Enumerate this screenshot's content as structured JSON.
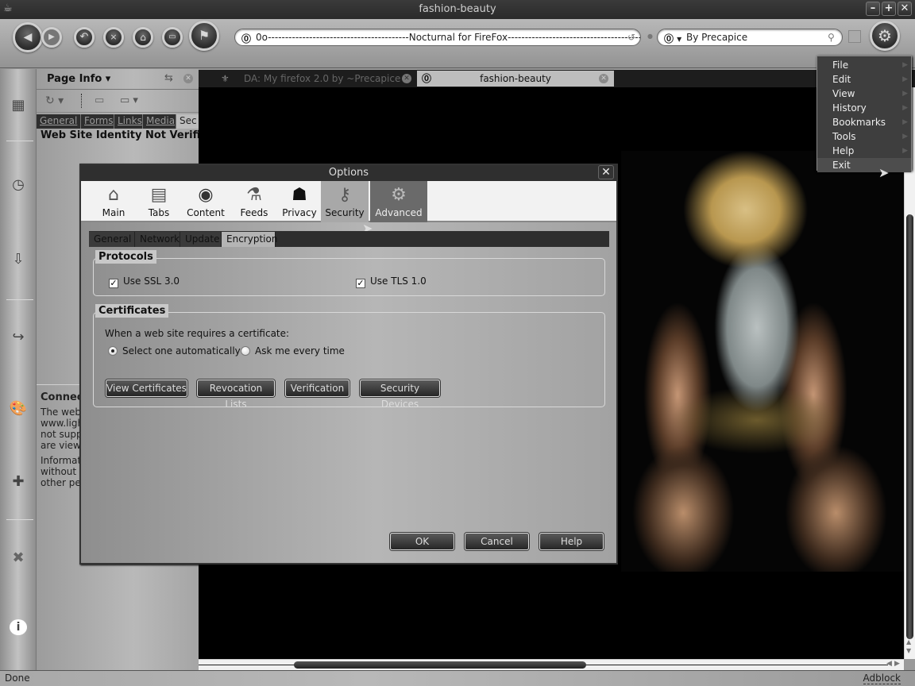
{
  "window": {
    "title": "fashion-beauty",
    "controls": {
      "minimize": "–",
      "maximize": "+",
      "close": "✕"
    }
  },
  "toolbar": {
    "url_value": "0o-----------------------------------------Nocturnal for FireFox---------------------------------------o0",
    "search_value": "By Precapice"
  },
  "sidebar": {
    "title": "Page Info",
    "tabs": [
      {
        "label": "General",
        "active": false
      },
      {
        "label": "Forms",
        "active": false
      },
      {
        "label": "Links",
        "active": false
      },
      {
        "label": "Media",
        "active": false
      },
      {
        "label": "Sec",
        "active": true
      }
    ],
    "identity_heading": "Web Site Identity Not Verified",
    "connection": {
      "heading": "Connect",
      "lines_1": [
        "The web",
        "www.ligh",
        "not supp",
        "are viewi"
      ],
      "lines_2": [
        "Informati",
        "without ",
        "other pe"
      ]
    }
  },
  "tabs": [
    {
      "label": "DA: My firefox 2.0 by ~Precapice",
      "active": false
    },
    {
      "label": "fashion-beauty",
      "active": true
    }
  ],
  "app_menu": {
    "items": [
      {
        "label": "File",
        "has_submenu": true
      },
      {
        "label": "Edit",
        "has_submenu": true
      },
      {
        "label": "View",
        "has_submenu": true
      },
      {
        "label": "History",
        "has_submenu": true
      },
      {
        "label": "Bookmarks",
        "has_submenu": true
      },
      {
        "label": "Tools",
        "has_submenu": true
      },
      {
        "label": "Help",
        "has_submenu": true
      },
      {
        "label": "Exit",
        "has_submenu": false,
        "hovered": true
      }
    ]
  },
  "dialog": {
    "title": "Options",
    "panes": [
      {
        "label": "Main",
        "icon": "house-icon"
      },
      {
        "label": "Tabs",
        "icon": "tabs-icon"
      },
      {
        "label": "Content",
        "icon": "eye-icon"
      },
      {
        "label": "Feeds",
        "icon": "feed-bottle-icon"
      },
      {
        "label": "Privacy",
        "icon": "ninja-icon"
      },
      {
        "label": "Security",
        "icon": "keys-icon"
      },
      {
        "label": "Advanced",
        "icon": "gears-icon",
        "selected": true
      }
    ],
    "subtabs": [
      {
        "label": "General",
        "active": false
      },
      {
        "label": "Network",
        "active": false
      },
      {
        "label": "Update",
        "active": false
      },
      {
        "label": "Encryption",
        "active": true
      }
    ],
    "protocols": {
      "legend": "Protocols",
      "ssl_label": "Use SSL 3.0",
      "ssl_checked": true,
      "tls_label": "Use TLS 1.0",
      "tls_checked": true
    },
    "certificates": {
      "legend": "Certificates",
      "prompt": "When a web site requires a certificate:",
      "option_auto": "Select one automatically",
      "option_ask": "Ask me every time",
      "selected": "auto",
      "buttons": {
        "view": "View Certificates",
        "revocation": "Revocation Lists",
        "verification": "Verification",
        "devices": "Security Devices"
      }
    },
    "buttons": {
      "ok": "OK",
      "cancel": "Cancel",
      "help": "Help"
    }
  },
  "statusbar": {
    "status": "Done",
    "adblock": "Adblock"
  }
}
